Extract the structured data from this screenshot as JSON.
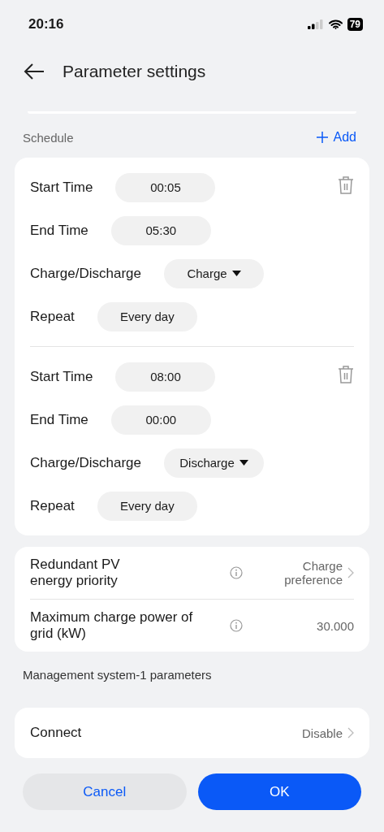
{
  "status_bar": {
    "time": "20:16",
    "battery": "79"
  },
  "header": {
    "title": "Parameter settings"
  },
  "schedule": {
    "title": "Schedule",
    "add_label": "Add",
    "entries": [
      {
        "fields": [
          {
            "label": "Start Time",
            "value": "00:05",
            "kind": "time"
          },
          {
            "label": "End Time",
            "value": "05:30",
            "kind": "time"
          },
          {
            "label": "Charge/Discharge",
            "value": "Charge",
            "kind": "dropdown"
          },
          {
            "label": "Repeat",
            "value": "Every day",
            "kind": "time"
          }
        ]
      },
      {
        "fields": [
          {
            "label": "Start Time",
            "value": "08:00",
            "kind": "time"
          },
          {
            "label": "End Time",
            "value": "00:00",
            "kind": "time"
          },
          {
            "label": "Charge/Discharge",
            "value": "Discharge",
            "kind": "dropdown"
          },
          {
            "label": "Repeat",
            "value": "Every day",
            "kind": "time"
          }
        ]
      }
    ]
  },
  "settings": [
    {
      "label": "Redundant PV energy priority",
      "value": "Charge preference",
      "info": true,
      "chevron": true
    },
    {
      "label": "Maximum charge power of grid (kW)",
      "value": "30.000",
      "info": true,
      "chevron": false
    }
  ],
  "management": {
    "title": "Management system-1 parameters",
    "items": [
      {
        "label": "Connect",
        "value": "Disable",
        "info": false,
        "chevron": true
      }
    ]
  },
  "buttons": [
    {
      "label": "Cancel",
      "kind": "secondary"
    },
    {
      "label": "OK",
      "kind": "primary"
    }
  ]
}
